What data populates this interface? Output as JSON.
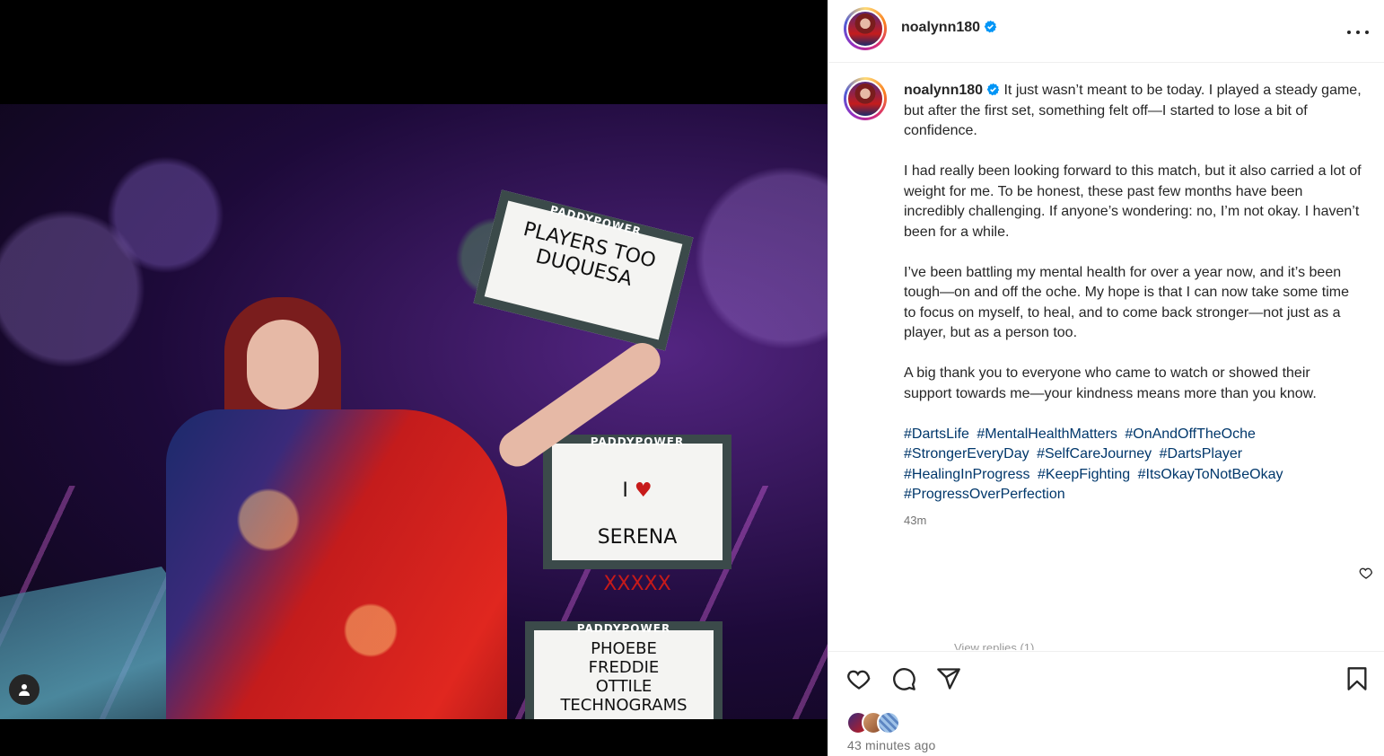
{
  "post": {
    "username": "noalynn180",
    "verified": true,
    "caption_paragraphs": [
      "It just wasn’t meant to be today. I played a steady game, but after the first set, something felt off—I started to lose a bit of confidence.",
      "I had really been looking forward to this match, but it also carried a lot of weight for me. To be honest, these past few months have been incredibly challenging. If anyone’s wondering: no, I’m not okay. I haven’t been for a while.",
      "I’ve been battling my mental health for over a year now, and it’s been tough—on and off the oche. My hope is that I can now take some time to focus on myself, to heal, and to come back stronger—not just as a player, but as a person too.",
      "A big thank you to everyone who came to watch or showed their support towards me—your kindness means more than you know."
    ],
    "hashtags": [
      "#DartsLife",
      "#MentalHealthMatters",
      "#OnAndOffTheOche",
      "#StrongerEveryDay",
      "#SelfCareJourney",
      "#DartsPlayer",
      "#HealingInProgress",
      "#KeepFighting",
      "#ItsOkayToNotBeOkay",
      "#ProgressOverPerfection"
    ],
    "caption_time": "43m",
    "view_replies_label": "View replies (1)",
    "posted_ago": "43 minutes ago"
  },
  "photo": {
    "sign1": {
      "brand": "PADDYPOWER",
      "text": "PLAYERS TOO\nDUQUESA"
    },
    "sign2": {
      "brand": "PADDYPOWER",
      "line1": "I",
      "line2": "SERENA",
      "line3": "XXXXX"
    },
    "sign3": {
      "brand": "PADDYPOWER",
      "text": "PHOEBE\nFREDDIE\nOTTILE\nTECHNOGRAMS"
    }
  },
  "icons": {
    "more": "more-options-icon",
    "verified": "verified-badge-icon",
    "like": "heart-icon",
    "comment": "comment-icon",
    "share": "share-icon",
    "save": "bookmark-icon",
    "tag": "user-tag-icon"
  },
  "colors": {
    "verified": "#0095f6",
    "hashtag": "#00376b",
    "muted": "#737373"
  }
}
